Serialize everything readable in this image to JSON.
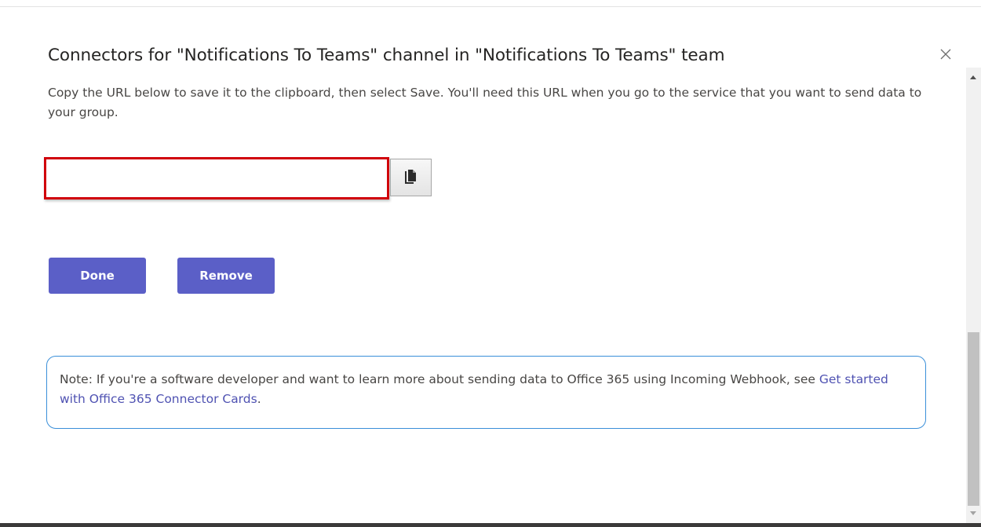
{
  "dialog": {
    "title": "Connectors for \"Notifications To Teams\" channel in \"Notifications To Teams\" team",
    "close_icon": "close-icon"
  },
  "instructions": {
    "text": "Copy the URL below to save it to the clipboard, then select Save. You'll need this URL when you go to the service that you want to send data to your group."
  },
  "url_field": {
    "value": "",
    "placeholder": ""
  },
  "copy_button": {
    "icon": "copy-icon"
  },
  "actions": {
    "done_label": "Done",
    "remove_label": "Remove"
  },
  "note": {
    "text": "Note: If you're a software developer and want to learn more about sending data to Office 365 using Incoming Webhook, see ",
    "link_text": "Get started with Office 365 Connector Cards",
    "trailing": "."
  },
  "colors": {
    "accent": "#5b5fc7",
    "link": "#4f52b2",
    "note_border": "#3a8fd9",
    "highlight_border": "#d0000a"
  }
}
